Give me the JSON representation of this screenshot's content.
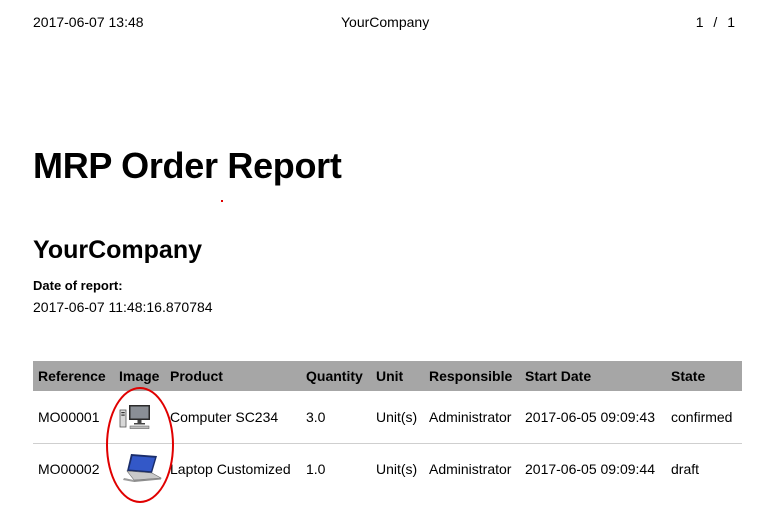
{
  "header": {
    "datetime": "2017-06-07 13:48",
    "company": "YourCompany",
    "page_number": "1 / 1"
  },
  "report": {
    "title": "MRP Order Report",
    "company_name": "YourCompany",
    "date_label": "Date of report:",
    "date_value": "2017-06-07 11:48:16.870784"
  },
  "table": {
    "columns": [
      "Reference",
      "Image",
      "Product",
      "Quantity",
      "Unit",
      "Responsible",
      "Start Date",
      "State"
    ],
    "rows": [
      {
        "reference": "MO00001",
        "image_icon": "desktop-computer-icon",
        "product": "Computer SC234",
        "quantity": "3.0",
        "unit": "Unit(s)",
        "responsible": "Administrator",
        "start_date": "2017-06-05 09:09:43",
        "state": "confirmed"
      },
      {
        "reference": "MO00002",
        "image_icon": "laptop-icon",
        "product": "Laptop Customized",
        "quantity": "1.0",
        "unit": "Unit(s)",
        "responsible": "Administrator",
        "start_date": "2017-06-05 09:09:44",
        "state": "draft"
      }
    ]
  },
  "colors": {
    "header_background": "#a6a6a6",
    "annotation": "#e00000"
  }
}
